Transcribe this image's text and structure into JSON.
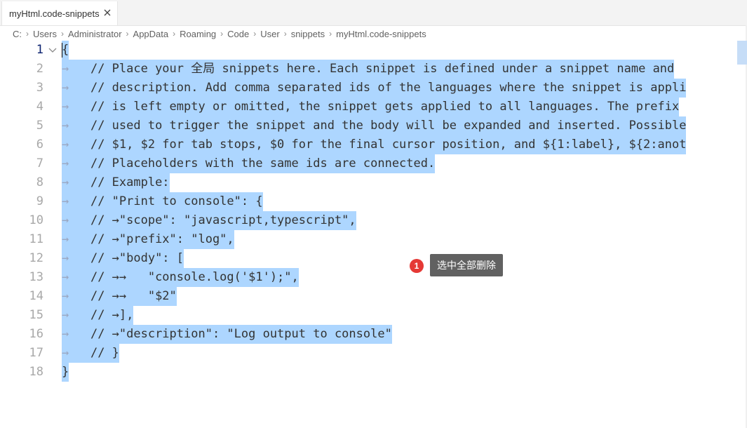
{
  "tab": {
    "title": "myHtml.code-snippets",
    "close_icon": "close-icon"
  },
  "breadcrumb": [
    "C:",
    "Users",
    "Administrator",
    "AppData",
    "Roaming",
    "Code",
    "User",
    "snippets",
    "myHtml.code-snippets"
  ],
  "editor": {
    "lines": [
      {
        "n": "1",
        "indent": "",
        "text": "{"
      },
      {
        "n": "2",
        "indent": "→   ",
        "text": "// Place your 全局 snippets here. Each snippet is defined under a snippet name and"
      },
      {
        "n": "3",
        "indent": "→   ",
        "text": "// description. Add comma separated ids of the languages where the snippet is appli"
      },
      {
        "n": "4",
        "indent": "→   ",
        "text": "// is left empty or omitted, the snippet gets applied to all languages. The prefix"
      },
      {
        "n": "5",
        "indent": "→   ",
        "text": "// used to trigger the snippet and the body will be expanded and inserted. Possible"
      },
      {
        "n": "6",
        "indent": "→   ",
        "text": "// $1, $2 for tab stops, $0 for the final cursor position, and ${1:label}, ${2:anot"
      },
      {
        "n": "7",
        "indent": "→   ",
        "text": "// Placeholders with the same ids are connected."
      },
      {
        "n": "8",
        "indent": "→   ",
        "text": "// Example:"
      },
      {
        "n": "9",
        "indent": "→   ",
        "text": "// \"Print to console\": {"
      },
      {
        "n": "10",
        "indent": "→   ",
        "text": "// →\"scope\": \"javascript,typescript\","
      },
      {
        "n": "11",
        "indent": "→   ",
        "text": "// →\"prefix\": \"log\","
      },
      {
        "n": "12",
        "indent": "→   ",
        "text": "// →\"body\": ["
      },
      {
        "n": "13",
        "indent": "→   ",
        "text": "// →→   \"console.log('$1');\","
      },
      {
        "n": "14",
        "indent": "→   ",
        "text": "// →→   \"$2\""
      },
      {
        "n": "15",
        "indent": "→   ",
        "text": "// →],"
      },
      {
        "n": "16",
        "indent": "→   ",
        "text": "// →\"description\": \"Log output to console\""
      },
      {
        "n": "17",
        "indent": "→   ",
        "text": "// }"
      },
      {
        "n": "18",
        "indent": "",
        "text": "}"
      }
    ],
    "fold_icon": "chevron-down-icon"
  },
  "annotation": {
    "badge": "1",
    "tooltip": "选中全部删除"
  },
  "colors": {
    "selection": "#add6ff",
    "badge": "#e53935",
    "tooltip_bg": "#616161"
  }
}
